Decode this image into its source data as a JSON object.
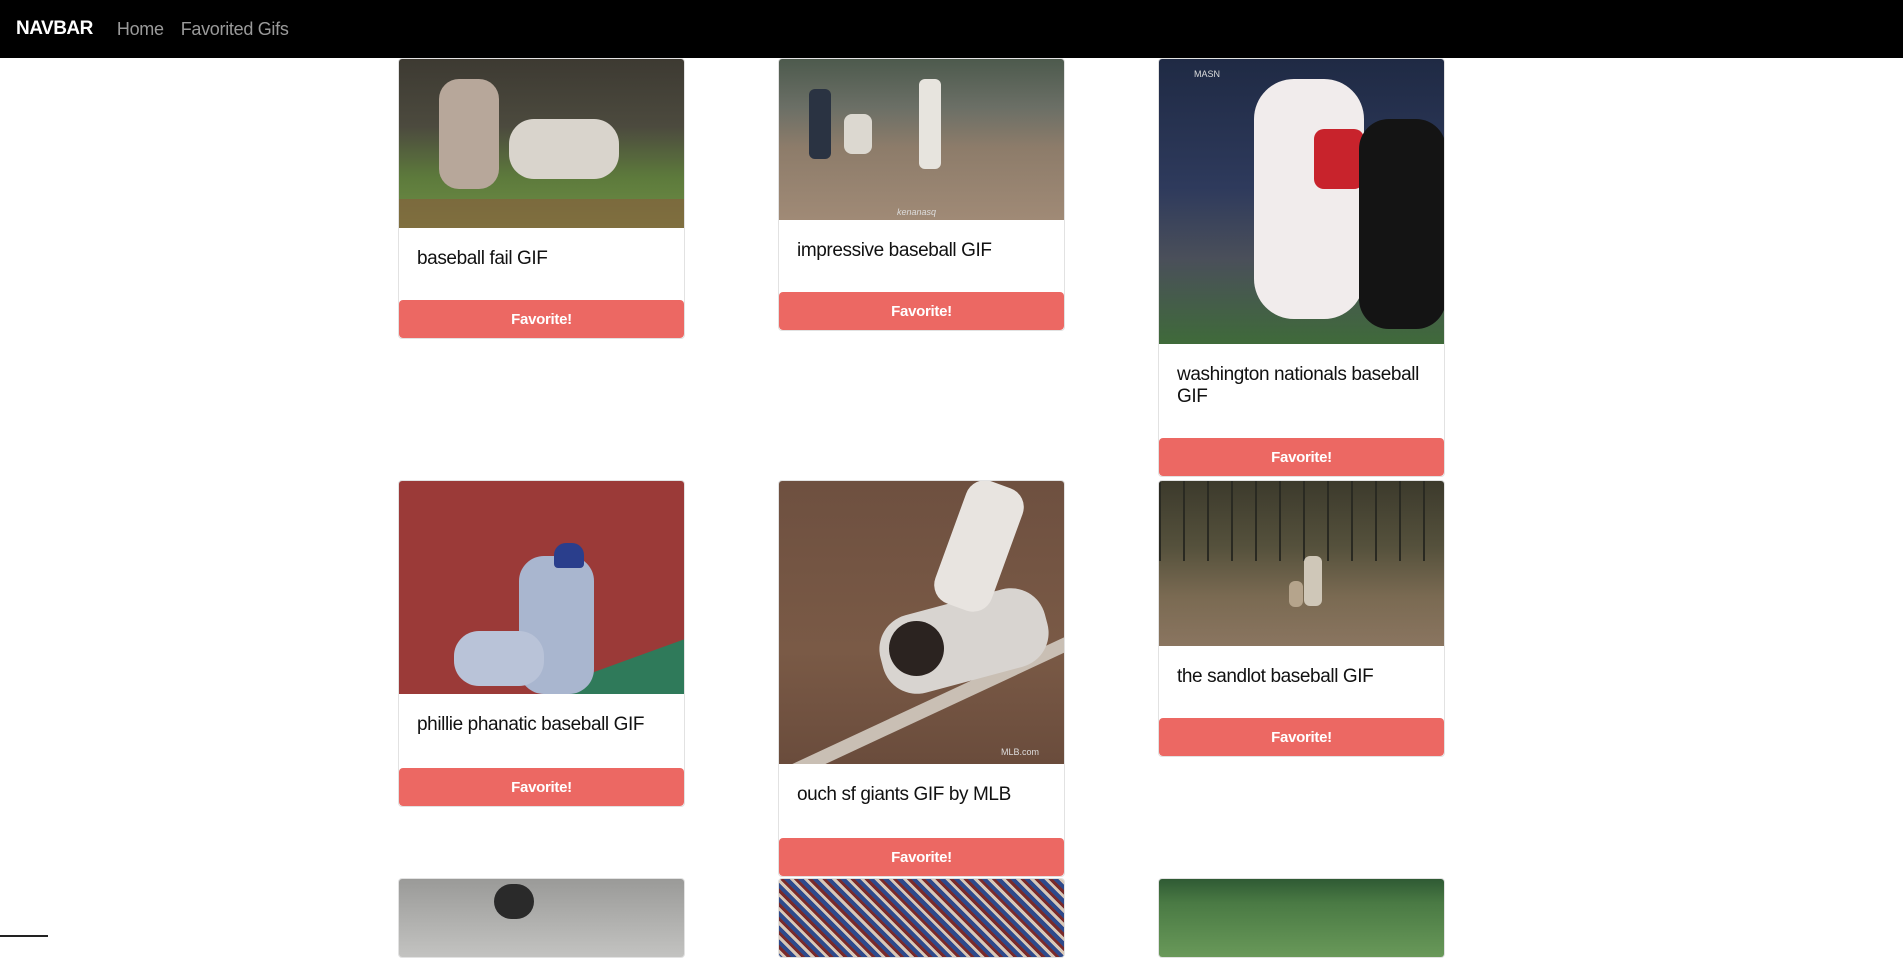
{
  "navbar": {
    "brand": "NAVBAR",
    "links": [
      "Home",
      "Favorited Gifs"
    ]
  },
  "favorite_label": "Favorite!",
  "cards": [
    {
      "title": "baseball fail GIF",
      "watermark": ""
    },
    {
      "title": "impressive baseball GIF",
      "watermark": "kenanasq"
    },
    {
      "title": "washington nationals baseball GIF",
      "watermark": "MASN"
    },
    {
      "title": "phillie phanatic baseball GIF",
      "watermark": ""
    },
    {
      "title": "ouch sf giants GIF by MLB",
      "watermark": "MLB.com"
    },
    {
      "title": "the sandlot baseball GIF",
      "watermark": ""
    }
  ],
  "colors": {
    "navbar_bg": "#000000",
    "favorite_button": "#ec6863",
    "nav_link": "#9a9a9a"
  }
}
